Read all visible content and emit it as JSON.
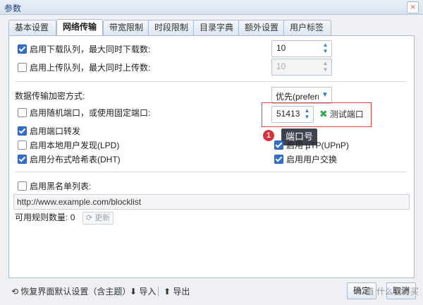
{
  "window": {
    "title": "参数",
    "close_glyph": "×"
  },
  "tabs": [
    {
      "label": "基本设置"
    },
    {
      "label": "网络传输"
    },
    {
      "label": "带宽限制"
    },
    {
      "label": "时段限制"
    },
    {
      "label": "目录字典"
    },
    {
      "label": "额外设置"
    },
    {
      "label": "用户标签"
    }
  ],
  "queue": {
    "download_label": "启用下载队列，最大同时下载数:",
    "download_checked": true,
    "download_value": "10",
    "upload_label": "启用上传队列，最大同时上传数:",
    "upload_checked": false,
    "upload_value": "10"
  },
  "encryption": {
    "label": "数据传输加密方式:",
    "selected": "优先(preferre"
  },
  "port": {
    "random_label": "启用随机端口，或使用固定端口:",
    "random_checked": false,
    "value": "51413",
    "test_label": "测试端口"
  },
  "options": {
    "forwarding": {
      "label": "启用端口转发",
      "checked": true
    },
    "lpd": {
      "label": "启用本地用户发现(LPD)",
      "checked": false
    },
    "utp": {
      "label": "启用 µTP(UPnP)",
      "checked": true
    },
    "dht": {
      "label": "启用分布式哈希表(DHT)",
      "checked": true
    },
    "pex": {
      "label": "启用用户交换",
      "checked": true
    }
  },
  "annotation": {
    "badge": "1",
    "tooltip": "端口号"
  },
  "blocklist": {
    "label": "启用黑名单列表:",
    "checked": false,
    "url": "http://www.example.com/blocklist",
    "rules_label": "可用规则数量:",
    "rules_count": "0",
    "update_label": "更新"
  },
  "footer": {
    "restore_label": "恢复界面默认设置（含主题）",
    "import_label": "导入",
    "export_label": "导出",
    "ok_label": "确定",
    "cancel_label": "取消"
  },
  "watermark": "值 什么值得买",
  "colors": {
    "accent": "#2f6fd1",
    "highlight": "#e0423a",
    "badge": "#d8313b"
  }
}
